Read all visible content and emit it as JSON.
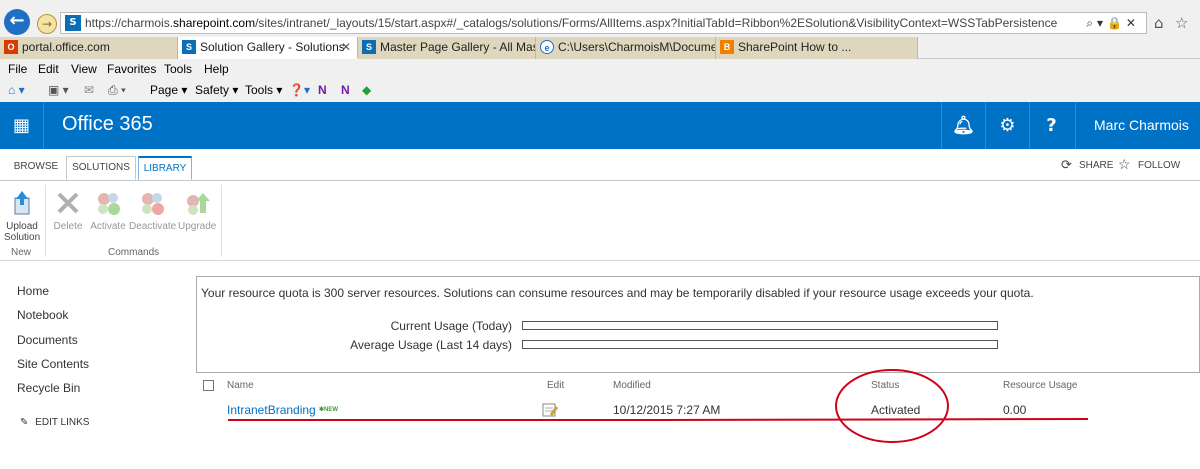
{
  "browser": {
    "url_prefix": "https://charmois.",
    "url_domain": "sharepoint.com",
    "url_rest": "/sites/intranet/_layouts/15/start.aspx#/_catalogs/solutions/Forms/AllItems.aspx?InitialTabId=Ribbon%2ESolution&VisibilityContext=WSSTabPersistence",
    "tabs": [
      {
        "label": "portal.office.com",
        "icon": "office-icon",
        "color": "#d83b01"
      },
      {
        "label": "Solution Gallery - Solutions",
        "icon": "sharepoint-icon",
        "color": "#0c6fb5"
      },
      {
        "label": "Master Page Gallery - All Mast...",
        "icon": "sharepoint-icon",
        "color": "#0c6fb5"
      },
      {
        "label": "C:\\Users\\CharmoisM\\Docume...",
        "icon": "ie-icon",
        "color": "#1f6fc5"
      },
      {
        "label": "SharePoint How to ...",
        "icon": "blogger-icon",
        "color": "#f57d00"
      }
    ],
    "close_glyph": "✕",
    "menu": [
      "File",
      "Edit",
      "View",
      "Favorites",
      "Tools",
      "Help"
    ],
    "commands": {
      "page": "Page ▾",
      "safety": "Safety ▾",
      "tools": "Tools ▾"
    }
  },
  "suite": {
    "brand": "Office 365",
    "user": "Marc Charmois",
    "accent": "#0072c6"
  },
  "ribbon": {
    "tabs": [
      "BROWSE",
      "SOLUTIONS",
      "LIBRARY"
    ],
    "share": "SHARE",
    "follow": "FOLLOW",
    "buttons": {
      "upload_1": "Upload",
      "upload_2": "Solution",
      "delete": "Delete",
      "activate": "Activate",
      "deactivate": "Deactivate",
      "upgrade": "Upgrade"
    },
    "groups": {
      "new": "New",
      "commands": "Commands"
    }
  },
  "nav": {
    "items": [
      "Home",
      "Notebook",
      "Documents",
      "Site Contents",
      "Recycle Bin"
    ],
    "edit_links": "EDIT LINKS"
  },
  "quota": {
    "message": "Your resource quota is 300 server resources. Solutions can consume resources and may be temporarily disabled if your resource usage exceeds your quota.",
    "current_label": "Current Usage (Today)",
    "average_label": "Average Usage (Last 14 days)",
    "current_fraction": 0,
    "average_fraction": 0
  },
  "list": {
    "headers": {
      "name": "Name",
      "edit": "Edit",
      "modified": "Modified",
      "status": "Status",
      "usage": "Resource Usage"
    },
    "rows": [
      {
        "name": "IntranetBranding",
        "new_badge": "NEW",
        "modified": "10/12/2015 7:27 AM",
        "status": "Activated",
        "usage": "0.00"
      }
    ]
  },
  "annotations": {
    "color": "#d0021b"
  }
}
